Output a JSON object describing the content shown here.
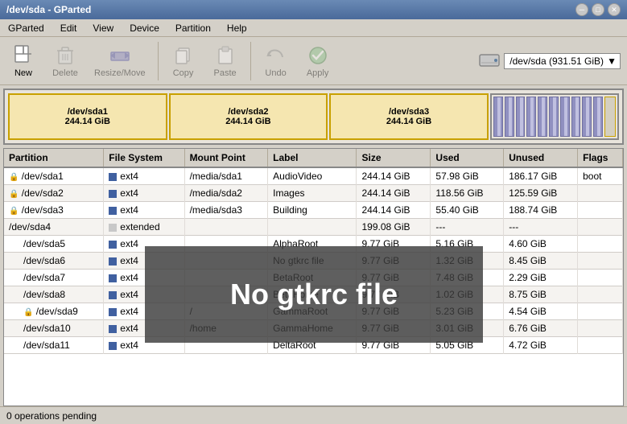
{
  "titleBar": {
    "title": "/dev/sda - GParted",
    "buttons": [
      "minimize",
      "maximize",
      "close"
    ]
  },
  "menuBar": {
    "items": [
      "GParted",
      "Edit",
      "View",
      "Device",
      "Partition",
      "Help"
    ]
  },
  "toolbar": {
    "buttons": [
      {
        "id": "new",
        "label": "New",
        "icon": "new-icon",
        "disabled": false
      },
      {
        "id": "delete",
        "label": "Delete",
        "icon": "delete-icon",
        "disabled": false
      },
      {
        "id": "resize-move",
        "label": "Resize/Move",
        "icon": "resize-icon",
        "disabled": false
      },
      {
        "id": "copy",
        "label": "Copy",
        "icon": "copy-icon",
        "disabled": false
      },
      {
        "id": "paste",
        "label": "Paste",
        "icon": "paste-icon",
        "disabled": false
      },
      {
        "id": "undo",
        "label": "Undo",
        "icon": "undo-icon",
        "disabled": false
      },
      {
        "id": "apply",
        "label": "Apply",
        "icon": "apply-icon",
        "disabled": false
      }
    ]
  },
  "deviceSelector": {
    "icon": "hdd-icon",
    "label": "/dev/sda (931.51 GiB)"
  },
  "partitionVisual": {
    "blocks": [
      {
        "id": "sda1",
        "label": "/dev/sda1",
        "size": "244.14 GiB",
        "type": "yellow"
      },
      {
        "id": "sda2",
        "label": "/dev/sda2",
        "size": "244.14 GiB",
        "type": "yellow"
      },
      {
        "id": "sda3",
        "label": "/dev/sda3",
        "size": "244.14 GiB",
        "type": "yellow"
      },
      {
        "id": "sda4",
        "label": "extended",
        "type": "striped"
      }
    ]
  },
  "tableHeaders": [
    "Partition",
    "File System",
    "Mount Point",
    "Label",
    "Size",
    "Used",
    "Unused",
    "Flags"
  ],
  "tableRows": [
    {
      "partition": "/dev/sda1",
      "locked": true,
      "fs": "ext4",
      "fsColor": "#4060a0",
      "mountPoint": "/media/sda1",
      "label": "AudioVideo",
      "size": "244.14 GiB",
      "used": "57.98 GiB",
      "unused": "186.17 GiB",
      "flags": "boot"
    },
    {
      "partition": "/dev/sda2",
      "locked": true,
      "fs": "ext4",
      "fsColor": "#4060a0",
      "mountPoint": "/media/sda2",
      "label": "Images",
      "size": "244.14 GiB",
      "used": "118.56 GiB",
      "unused": "125.59 GiB",
      "flags": ""
    },
    {
      "partition": "/dev/sda3",
      "locked": true,
      "fs": "ext4",
      "fsColor": "#4060a0",
      "mountPoint": "/media/sda3",
      "label": "Building",
      "size": "244.14 GiB",
      "used": "55.40 GiB",
      "unused": "188.74 GiB",
      "flags": ""
    },
    {
      "partition": "/dev/sda4",
      "locked": false,
      "fs": "extended",
      "fsColor": "#c8c8c8",
      "mountPoint": "",
      "label": "",
      "size": "199.08 GiB",
      "used": "---",
      "unused": "---",
      "flags": ""
    },
    {
      "partition": "  /dev/sda5",
      "locked": false,
      "fs": "ext4",
      "fsColor": "#4060a0",
      "mountPoint": "",
      "label": "AlphaRoot",
      "size": "9.77 GiB",
      "used": "5.16 GiB",
      "unused": "4.60 GiB",
      "flags": ""
    },
    {
      "partition": "  /dev/sda6",
      "locked": false,
      "fs": "ext4",
      "fsColor": "#4060a0",
      "mountPoint": "",
      "label": "No gtkrc file",
      "size": "9.77 GiB",
      "used": "1.32 GiB",
      "unused": "8.45 GiB",
      "flags": ""
    },
    {
      "partition": "  /dev/sda7",
      "locked": false,
      "fs": "ext4",
      "fsColor": "#4060a0",
      "mountPoint": "",
      "label": "BetaRoot",
      "size": "9.77 GiB",
      "used": "7.48 GiB",
      "unused": "2.29 GiB",
      "flags": ""
    },
    {
      "partition": "  /dev/sda8",
      "locked": false,
      "fs": "ext4",
      "fsColor": "#4060a0",
      "mountPoint": "",
      "label": "BetaHome",
      "size": "9.77 GiB",
      "used": "1.02 GiB",
      "unused": "8.75 GiB",
      "flags": ""
    },
    {
      "partition": "  /dev/sda9",
      "locked": true,
      "fs": "ext4",
      "fsColor": "#4060a0",
      "mountPoint": "/",
      "label": "GammaRoot",
      "size": "9.77 GiB",
      "used": "5.23 GiB",
      "unused": "4.54 GiB",
      "flags": ""
    },
    {
      "partition": "  /dev/sda10",
      "locked": false,
      "fs": "ext4",
      "fsColor": "#4060a0",
      "mountPoint": "/home",
      "label": "GammaHome",
      "size": "9.77 GiB",
      "used": "3.01 GiB",
      "unused": "6.76 GiB",
      "flags": ""
    },
    {
      "partition": "  /dev/sda11",
      "locked": false,
      "fs": "ext4",
      "fsColor": "#4060a0",
      "mountPoint": "",
      "label": "DeltaRoot",
      "size": "9.77 GiB",
      "used": "5.05 GiB",
      "unused": "4.72 GiB",
      "flags": ""
    }
  ],
  "statusBar": {
    "text": "0 operations pending"
  },
  "overlay": {
    "text": "No gtkrc file"
  }
}
